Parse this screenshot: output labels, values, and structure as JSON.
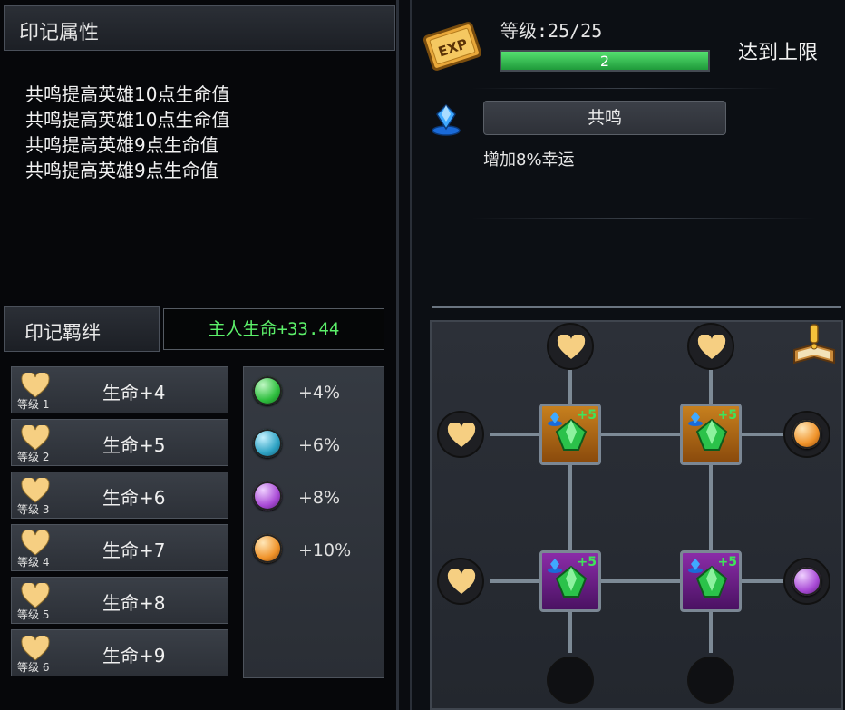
{
  "left_panel": {
    "title": "印记属性",
    "properties": [
      "共鸣提高英雄10点生命值",
      "共鸣提高英雄10点生命值",
      "共鸣提高英雄9点生命值",
      "共鸣提高英雄9点生命值"
    ],
    "bond_label": "印记羁绊",
    "bond_value": "主人生命+33.44",
    "levels": [
      {
        "level": "等级 1",
        "bonus": "生命+4"
      },
      {
        "level": "等级 2",
        "bonus": "生命+5"
      },
      {
        "level": "等级 3",
        "bonus": "生命+6"
      },
      {
        "level": "等级 4",
        "bonus": "生命+7"
      },
      {
        "level": "等级 5",
        "bonus": "生命+8"
      },
      {
        "level": "等级 6",
        "bonus": "生命+9"
      }
    ],
    "gems": [
      {
        "color": "#2fbf3f",
        "bonus": "+4%",
        "icon": "green-gem-orb"
      },
      {
        "color": "#2fa3c4",
        "bonus": "+6%",
        "icon": "cyan-gem-orb"
      },
      {
        "color": "#a94bd6",
        "bonus": "+8%",
        "icon": "purple-gem-orb"
      },
      {
        "color": "#f0932a",
        "bonus": "+10%",
        "icon": "orange-gem-orb"
      }
    ]
  },
  "right_panel": {
    "level_text": "等级:25/25",
    "exp_bar_value": "2",
    "exp_fill_fraction": 1.0,
    "maxed_text": "达到上限",
    "resonate_button": "共鸣",
    "effect_text": "增加8%幸运",
    "slot_bonus": "+5",
    "exp_icon": "exp-badge-icon",
    "colors": {
      "exp_green": "#3ec95a",
      "heart": "#f6cf82"
    }
  }
}
